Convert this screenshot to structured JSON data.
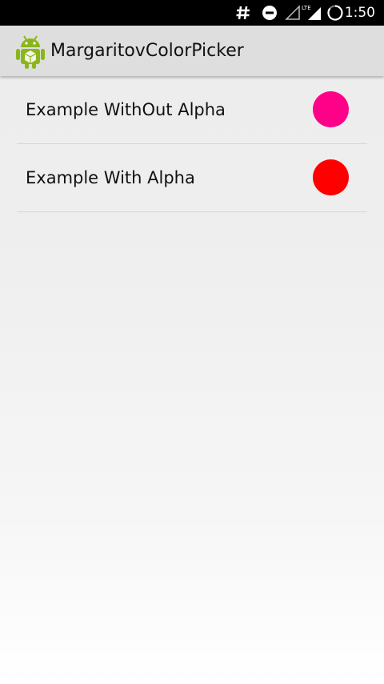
{
  "status_bar": {
    "time": "1:50",
    "icons": [
      "hash-icon",
      "do-not-disturb-icon",
      "signal-empty-icon",
      "lte-signal-icon",
      "battery-charging-icon"
    ],
    "lte_label": "LTE"
  },
  "action_bar": {
    "icon": "android-icon",
    "title": "MargaritovColorPicker"
  },
  "list": {
    "items": [
      {
        "label": "Example WithOut Alpha",
        "color": "#ff0089"
      },
      {
        "label": "Example With Alpha",
        "color": "#ff0000"
      }
    ]
  }
}
